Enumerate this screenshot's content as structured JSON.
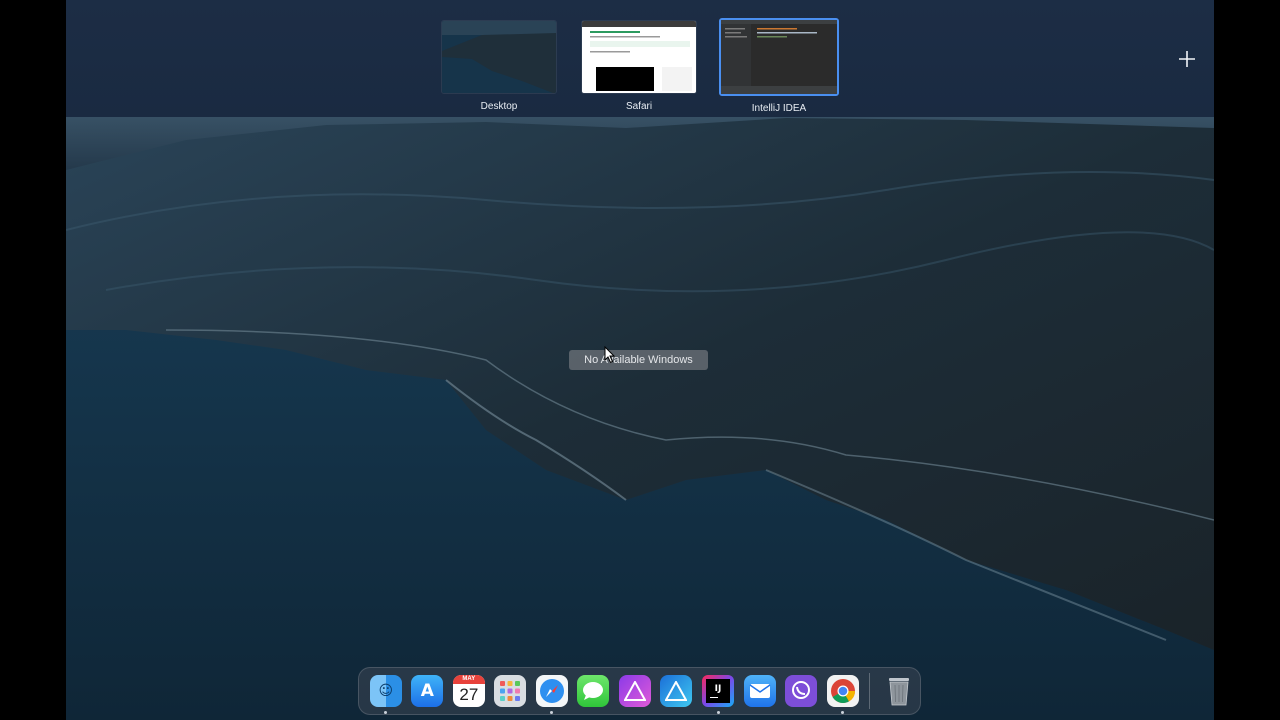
{
  "spaces": {
    "items": [
      {
        "label": "Desktop"
      },
      {
        "label": "Safari"
      },
      {
        "label": "IntelliJ IDEA"
      }
    ],
    "add_icon": "plus-icon",
    "selected": "IntelliJ IDEA"
  },
  "center_message": "No Available Windows",
  "calendar": {
    "month": "MAY",
    "day": "27"
  },
  "dock": {
    "apps": [
      {
        "name": "Finder",
        "icon": "finder-icon",
        "running": true
      },
      {
        "name": "App Store",
        "icon": "app-store-icon",
        "running": false
      },
      {
        "name": "Calendar",
        "icon": "calendar-icon",
        "running": false
      },
      {
        "name": "Launchpad",
        "icon": "launchpad-icon",
        "running": false
      },
      {
        "name": "Safari",
        "icon": "safari-icon",
        "running": true
      },
      {
        "name": "Messages",
        "icon": "messages-icon",
        "running": false
      },
      {
        "name": "Affinity Photo",
        "icon": "affinity-photo-icon",
        "running": false
      },
      {
        "name": "Affinity Designer",
        "icon": "affinity-designer-icon",
        "running": false
      },
      {
        "name": "IntelliJ IDEA",
        "icon": "intellij-icon",
        "running": true
      },
      {
        "name": "Mail",
        "icon": "mail-icon",
        "running": false
      },
      {
        "name": "Viber",
        "icon": "viber-icon",
        "running": false
      },
      {
        "name": "Chrome",
        "icon": "chrome-icon",
        "running": true
      },
      {
        "name": "Trash",
        "icon": "trash-icon",
        "running": false
      }
    ]
  },
  "colors": {
    "spaces_bar": "#1c2d45",
    "selected_border": "#4a8ff0",
    "sea": "#14324a",
    "land": "#1c2a34"
  }
}
